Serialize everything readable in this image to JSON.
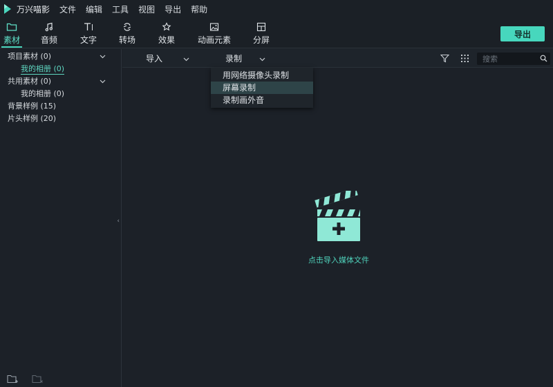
{
  "app": {
    "title": "万兴喵影",
    "menus": [
      "文件",
      "编辑",
      "工具",
      "视图",
      "导出",
      "帮助"
    ]
  },
  "toolbar": {
    "tools": [
      {
        "label": "素材",
        "icon": "folder-icon"
      },
      {
        "label": "音频",
        "icon": "music-note-icon"
      },
      {
        "label": "文字",
        "icon": "text-icon"
      },
      {
        "label": "转场",
        "icon": "transition-icon"
      },
      {
        "label": "效果",
        "icon": "effects-icon"
      },
      {
        "label": "动画元素",
        "icon": "image-icon"
      },
      {
        "label": "分屏",
        "icon": "split-screen-icon"
      }
    ],
    "active_index": 0,
    "export_label": "导出"
  },
  "sidebar": {
    "items": [
      {
        "label": "项目素材 (0)",
        "expandable": true
      },
      {
        "label": "我的相册 (0)",
        "selected": true
      },
      {
        "label": "共用素材 (0)",
        "expandable": true
      },
      {
        "label": "我的相册 (0)"
      },
      {
        "label": "背景样例 (15)"
      },
      {
        "label": "片头样例 (20)"
      }
    ]
  },
  "media_bar": {
    "import_label": "导入",
    "record_label": "录制",
    "search_placeholder": "搜索"
  },
  "record_menu": {
    "options": [
      "用网络摄像头录制",
      "屏幕录制",
      "录制画外音"
    ],
    "hovered_index": 1
  },
  "empty_state": {
    "text": "点击导入媒体文件"
  },
  "colors": {
    "accent": "#47d7bd",
    "background": "#1c2128",
    "toolbar": "#1b2026"
  }
}
